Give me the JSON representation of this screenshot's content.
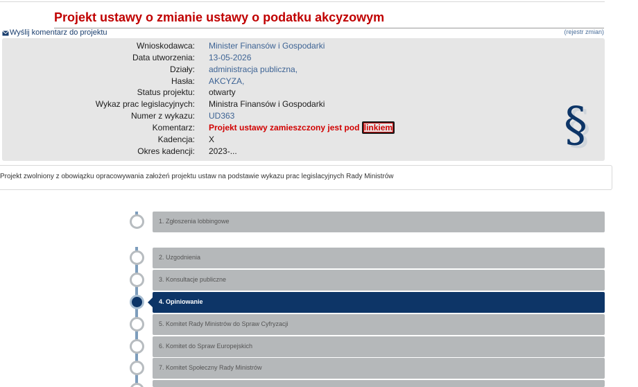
{
  "page": {
    "title": "Projekt ustawy o zmianie ustawy o podatku akcyzowym",
    "send_comment_label": "Wyślij komentarz do projektu",
    "register_label": "(rejestr zmian)"
  },
  "info": {
    "applicant_label": "Wnioskodawca:",
    "applicant_value": "Minister Finansów i Gospodarki",
    "created_label": "Data utworzenia:",
    "created_value": "13-05-2026",
    "sections_label": "Działy:",
    "sections_value": "administracja publiczna",
    "sections_sep": ",",
    "keywords_label": "Hasła:",
    "keywords_value": "AKCYZA",
    "keywords_sep": ",",
    "status_label": "Status projektu:",
    "status_value": "otwarty",
    "worklist_label": "Wykaz prac legislacyjnych:",
    "worklist_value": "Ministra Finansów i Gospodarki",
    "number_label": "Numer z wykazu:",
    "number_value": "UD363",
    "comment_label": "Komentarz:",
    "comment_value": "Projekt ustawy zamieszczony jest pod ",
    "comment_link": "linkiem",
    "term_label": "Kadencja:",
    "term_value": "X",
    "term_period_label": "Okres kadencji:",
    "term_period_value": "2023-..."
  },
  "notice": {
    "text": "Projekt zwolniony z obowiązku opracowywania założeń projektu ustaw na podstawie wykazu prac legislacyjnych Rady Ministrów"
  },
  "steps": {
    "s1": "1. Zgłoszenia lobbingowe",
    "s2": "2. Uzgodnienia",
    "s3": "3. Konsultacje publiczne",
    "s4": "4. Opiniowanie",
    "s5": "5. Komitet Rady Ministrów do Spraw Cyfryzacji",
    "s6": "6. Komitet do Spraw Europejskich",
    "s7": "7. Komitet Społeczny Rady Ministrów",
    "active_step": 4
  },
  "icons": {
    "envelope": "envelope-icon",
    "paragraph": "paragraph-icon"
  },
  "colors": {
    "title": "#c00000",
    "link": "#3d6394",
    "alert": "#d10000",
    "active_step": "#0d3567",
    "inactive_step": "#b5b8ba",
    "info_background": "#e6e6e6"
  }
}
